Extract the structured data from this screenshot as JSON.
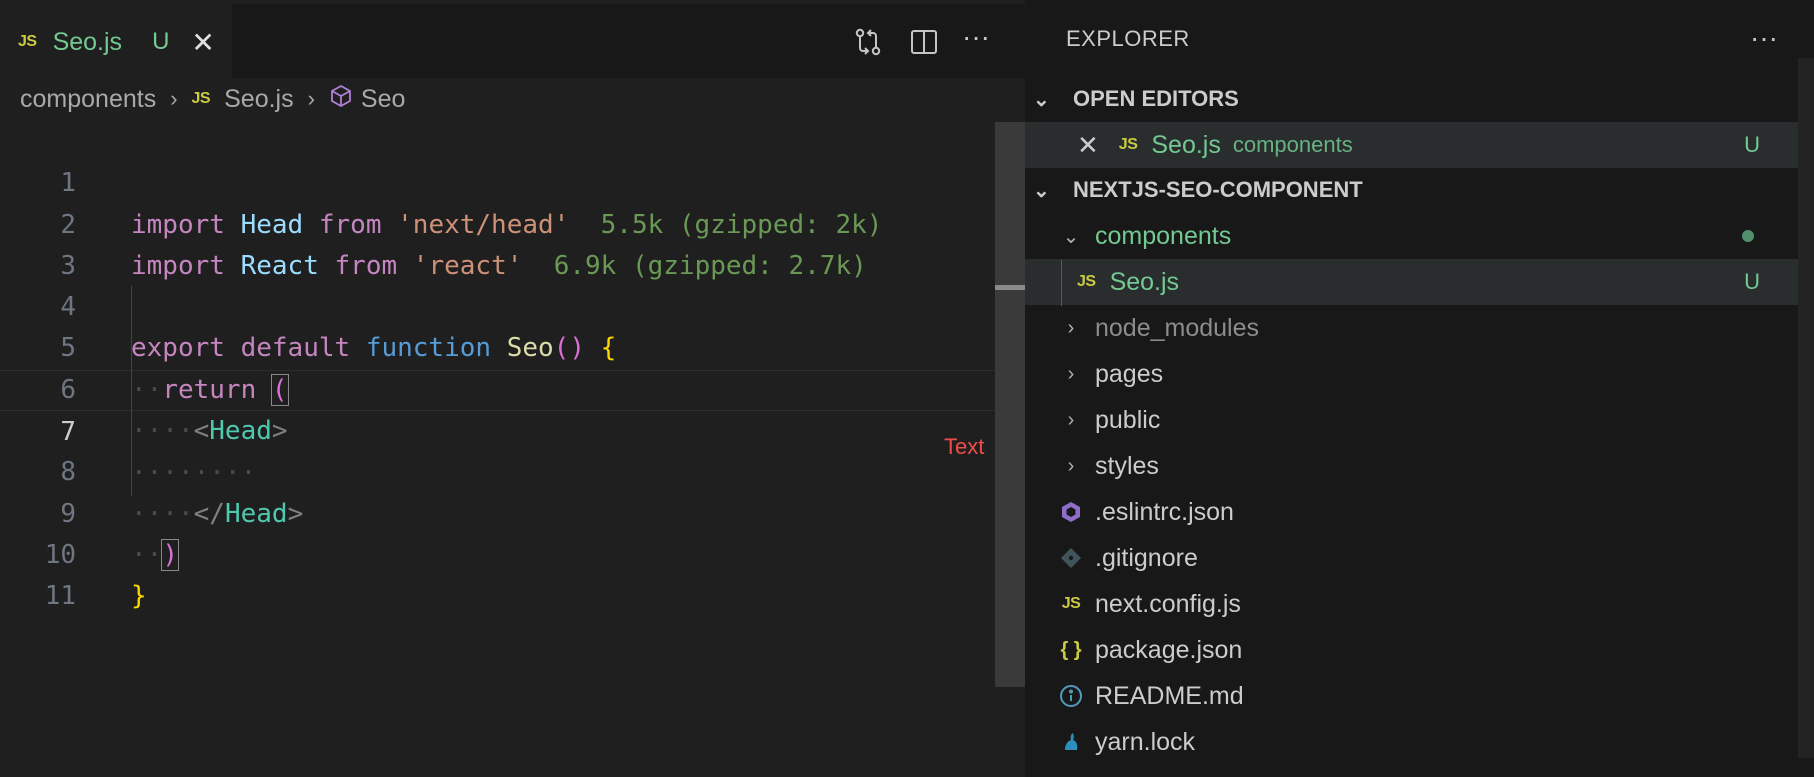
{
  "tab": {
    "badge": "JS",
    "name": "Seo.js",
    "status": "U",
    "close": "✕"
  },
  "toolbar": {
    "more": "···"
  },
  "breadcrumb": {
    "folder": "components",
    "file_badge": "JS",
    "file": "Seo.js",
    "symbol": "Seo",
    "sep": "›"
  },
  "code": {
    "line_numbers": [
      "1",
      "2",
      "3",
      "4",
      "5",
      "6",
      "7",
      "8",
      "9",
      "10",
      "11"
    ],
    "l1": {
      "kw": "import",
      "id": "Head",
      "from": "from",
      "str": "'next/head'",
      "size": "5.5k (gzipped: 2k)"
    },
    "l2": {
      "kw": "import",
      "id": "React",
      "from": "from",
      "str": "'react'",
      "size": "6.9k (gzipped: 2.7k)"
    },
    "l4": {
      "export": "export",
      "default": "default",
      "function": "function",
      "name": "Seo",
      "open": "()",
      "brace": "{"
    },
    "l5": {
      "ret": "return",
      "paren": "("
    },
    "l6": {
      "lt": "<",
      "tag": "Head",
      "gt": ">"
    },
    "l7": {
      "ws": "········"
    },
    "l8": {
      "lt": "</",
      "tag": "Head",
      "gt": ">"
    },
    "l9": {
      "paren": ")"
    },
    "l10": {
      "brace": "}"
    },
    "ws": {
      "l5": "··",
      "l6": "····",
      "l8": "····",
      "l9": "··"
    }
  },
  "hint": "Text",
  "explorer": {
    "title": "EXPLORER",
    "more": "···",
    "open_editors": "OPEN EDITORS",
    "open_editor": {
      "close": "✕",
      "badge": "JS",
      "name": "Seo.js",
      "dir": "components",
      "status": "U"
    },
    "project": "NEXTJS-SEO-COMPONENT",
    "tree": {
      "components": "components",
      "seo_badge": "JS",
      "seo": "Seo.js",
      "seo_status": "U",
      "node_modules": "node_modules",
      "pages": "pages",
      "public": "public",
      "styles": "styles",
      "eslintrc": ".eslintrc.json",
      "gitignore": ".gitignore",
      "next_badge": "JS",
      "next_config": "next.config.js",
      "package_badge": "{ }",
      "package": "package.json",
      "readme": "README.md",
      "yarn": "yarn.lock"
    }
  },
  "chevrons": {
    "down": "⌄",
    "right": "›"
  },
  "colors": {
    "git_untracked": "#73c991",
    "js_badge": "#cbcb41",
    "hint": "#f14c4c"
  }
}
